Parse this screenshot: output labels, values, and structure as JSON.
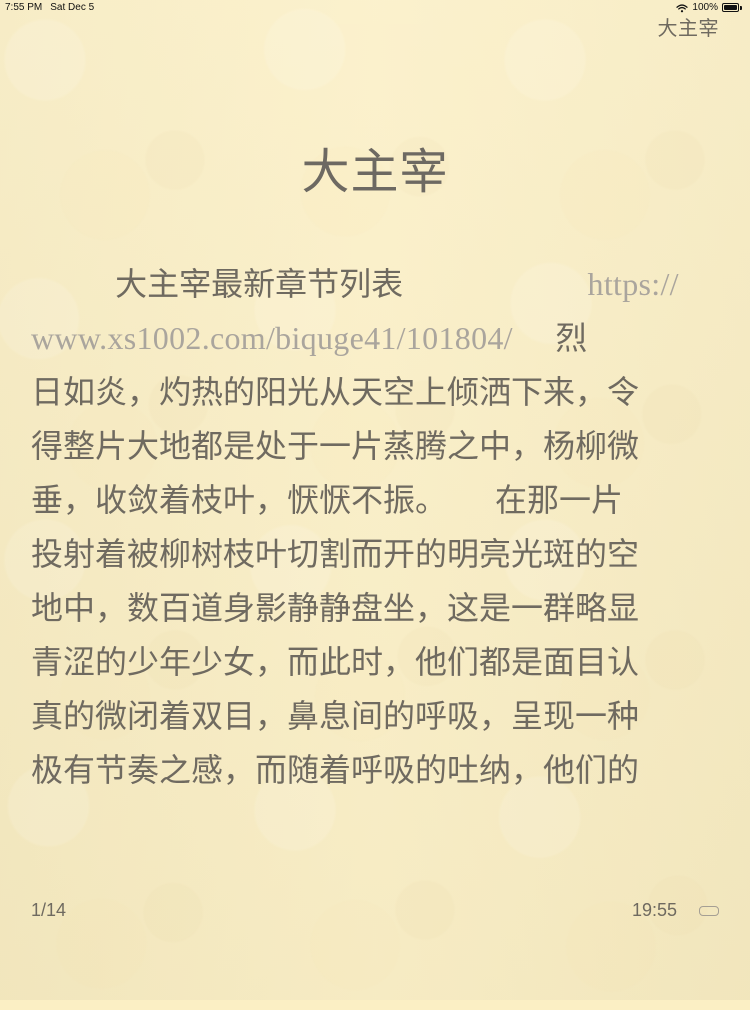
{
  "status_bar": {
    "time": "7:55 PM",
    "date": "Sat Dec 5",
    "battery_text": "100%"
  },
  "header": {
    "book_title": "大主宰"
  },
  "chapter": {
    "title": "大主宰"
  },
  "content": {
    "line_1_text": "大主宰最新章节列表",
    "line_1_url": "https://",
    "line_2_url": "www.xs1002.com/biquge41/101804/",
    "line_2_text": "烈",
    "line_3": "日如炎，灼热的阳光从天空上倾洒下来，令",
    "line_4": "得整片大地都是处于一片蒸腾之中，杨柳微",
    "line_5": "垂，收敛着枝叶，恹恹不振。　　在那一片",
    "line_6": "投射着被柳树枝叶切割而开的明亮光斑的空",
    "line_7": "地中，数百道身影静静盘坐，这是一群略显",
    "line_8": "青涩的少年少女，而此时，他们都是面目认",
    "line_9": "真的微闭着双目，鼻息间的呼吸，呈现一种",
    "line_10": "极有节奏之感，而随着呼吸的吐纳，他们的"
  },
  "footer": {
    "page_indicator": "1/14",
    "time": "19:55"
  }
}
